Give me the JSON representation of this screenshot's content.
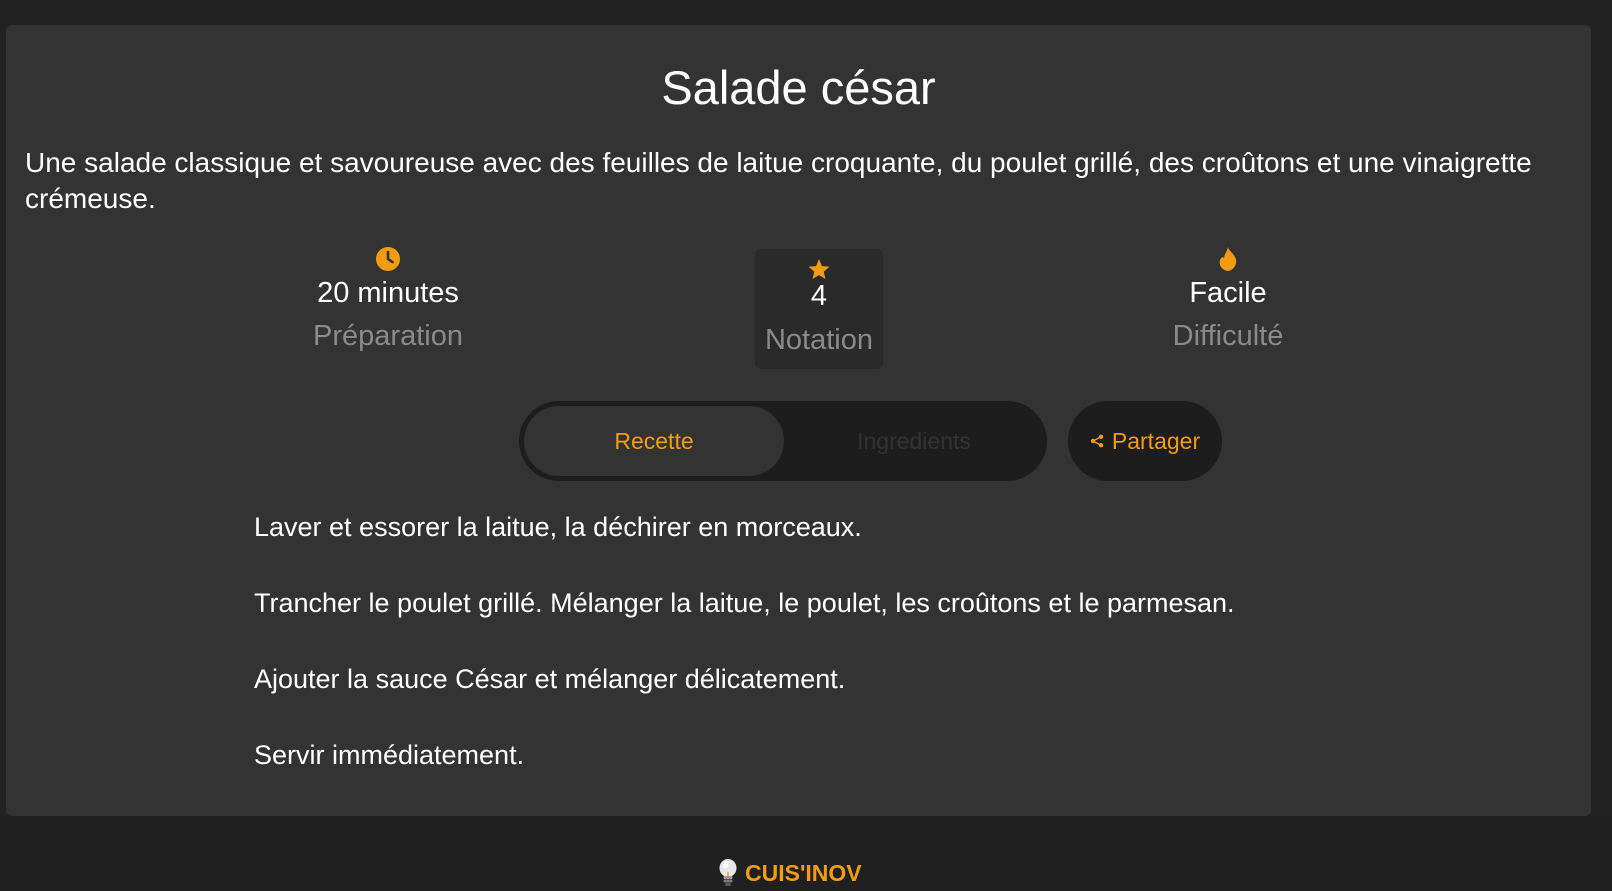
{
  "recipe": {
    "title": "Salade césar",
    "description": "Une salade classique et savoureuse avec des feuilles de laitue croquante, du poulet grillé, des croûtons et une vinaigrette crémeuse.",
    "stats": {
      "prep_time": {
        "value": "20 minutes",
        "label": "Préparation",
        "icon": "clock-icon"
      },
      "rating": {
        "value": "4",
        "label": "Notation",
        "icon": "star-icon"
      },
      "difficulty": {
        "value": "Facile",
        "label": "Difficulté",
        "icon": "flame-icon"
      }
    },
    "tabs": {
      "recipe_label": "Recette",
      "ingredients_label": "Ingredients",
      "active": "Recette"
    },
    "share_label": "Partager",
    "steps": [
      "Laver et essorer la laitue, la déchirer en morceaux.",
      "Trancher le poulet grillé. Mélanger la laitue, le poulet, les croûtons et le parmesan.",
      "Ajouter la sauce César et mélanger délicatement.",
      "Servir immédiatement."
    ]
  },
  "footer": {
    "brand": "CUIS'INOV",
    "brand_icon": "lightbulb-icon"
  },
  "colors": {
    "accent": "#f39c12",
    "background": "#222222",
    "card": "#333333",
    "muted_text": "#8a8a8a"
  }
}
